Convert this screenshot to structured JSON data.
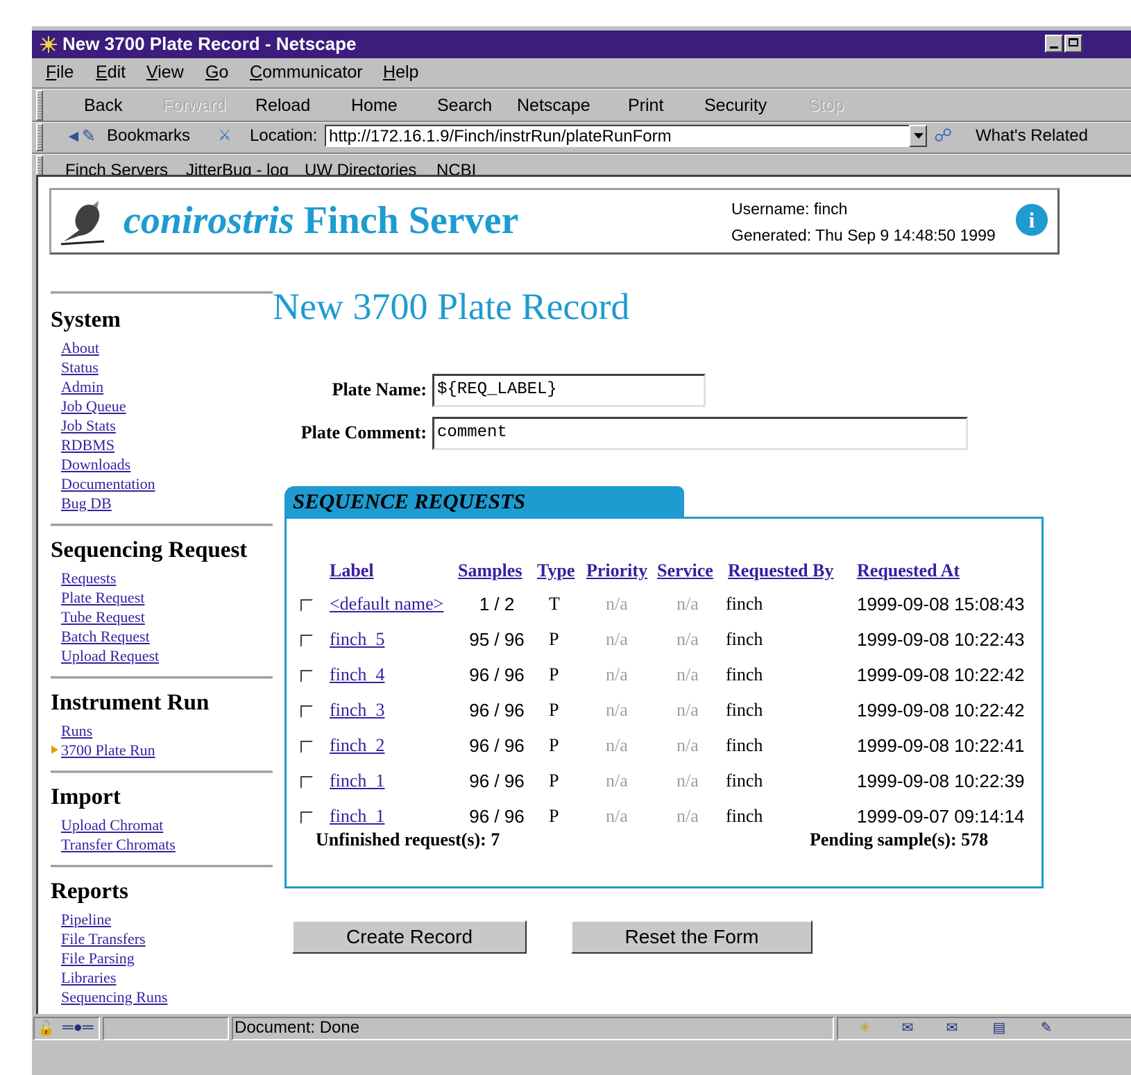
{
  "window": {
    "title": "New 3700 Plate Record - Netscape"
  },
  "menu": [
    {
      "key": "F",
      "rest": "ile"
    },
    {
      "key": "E",
      "rest": "dit"
    },
    {
      "key": "V",
      "rest": "iew"
    },
    {
      "key": "G",
      "rest": "o"
    },
    {
      "key": "C",
      "rest": "ommunicator"
    },
    {
      "key": "H",
      "rest": "elp"
    }
  ],
  "toolbar": {
    "back": "Back",
    "forward": "Forward",
    "reload": "Reload",
    "home": "Home",
    "search": "Search",
    "netscape": "Netscape",
    "print": "Print",
    "security": "Security",
    "stop": "Stop"
  },
  "location": {
    "bookmarks": "Bookmarks",
    "label": "Location:",
    "url": "http://172.16.1.9/Finch/instrRun/plateRunForm",
    "related": "What's Related"
  },
  "personal": [
    "Finch Servers",
    "JitterBug - log",
    "UW Directories",
    "NCBI"
  ],
  "banner": {
    "title_italic": "conirostris",
    "title_rest": " Finch Server",
    "username": "Username:  finch",
    "generated": "Generated:  Thu Sep 9 14:48:50 1999"
  },
  "sidebar": {
    "system": {
      "title": "System",
      "links": [
        "About",
        "Status",
        "Admin",
        "Job Queue",
        "Job Stats",
        "RDBMS",
        "Downloads",
        "Documentation",
        "Bug DB"
      ]
    },
    "sequencing": {
      "title": "Sequencing Request",
      "links": [
        "Requests",
        "Plate Request",
        "Tube Request",
        "Batch Request",
        "Upload Request"
      ]
    },
    "instrument": {
      "title": "Instrument Run",
      "links": [
        "Runs",
        "3700 Plate Run"
      ]
    },
    "import": {
      "title": "Import",
      "links": [
        "Upload Chromat",
        "Transfer Chromats"
      ]
    },
    "reports": {
      "title": "Reports",
      "links": [
        "Pipeline",
        "File Transfers",
        "File Parsing",
        "Libraries",
        "Sequencing Runs"
      ]
    }
  },
  "page": {
    "heading": "New 3700 Plate Record",
    "plate_name_label": "Plate Name:",
    "plate_name_value": "${REQ_LABEL}",
    "plate_comment_label": "Plate Comment:",
    "plate_comment_value": "comment"
  },
  "sequence": {
    "title": "SEQUENCE REQUESTS",
    "headers": {
      "label": "Label",
      "samples": "Samples",
      "type": "Type",
      "priority": "Priority",
      "service": "Service",
      "requested_by": "Requested By",
      "requested_at": "Requested At"
    },
    "rows": [
      {
        "label": "<default name>",
        "samples": "1 / 2",
        "type": "T",
        "priority": "n/a",
        "service": "n/a",
        "by": "finch",
        "at": "1999-09-08 15:08:43"
      },
      {
        "label": "finch_5",
        "samples": "95 / 96",
        "type": "P",
        "priority": "n/a",
        "service": "n/a",
        "by": "finch",
        "at": "1999-09-08 10:22:43"
      },
      {
        "label": "finch_4",
        "samples": "96 / 96",
        "type": "P",
        "priority": "n/a",
        "service": "n/a",
        "by": "finch",
        "at": "1999-09-08 10:22:42"
      },
      {
        "label": "finch_3",
        "samples": "96 / 96",
        "type": "P",
        "priority": "n/a",
        "service": "n/a",
        "by": "finch",
        "at": "1999-09-08 10:22:42"
      },
      {
        "label": "finch_2",
        "samples": "96 / 96",
        "type": "P",
        "priority": "n/a",
        "service": "n/a",
        "by": "finch",
        "at": "1999-09-08 10:22:41"
      },
      {
        "label": "finch_1",
        "samples": "96 / 96",
        "type": "P",
        "priority": "n/a",
        "service": "n/a",
        "by": "finch",
        "at": "1999-09-08 10:22:39"
      },
      {
        "label": "finch_1",
        "samples": "96 / 96",
        "type": "P",
        "priority": "n/a",
        "service": "n/a",
        "by": "finch",
        "at": "1999-09-07 09:14:14"
      }
    ],
    "unfinished": "Unfinished request(s):  7",
    "pending": "Pending sample(s):  578"
  },
  "buttons": {
    "create": "Create Record",
    "reset": "Reset the Form"
  },
  "status": {
    "text": "Document: Done"
  },
  "colors": {
    "accent": "#1e9bd0",
    "link": "#3b1ea0",
    "titlebar": "#3c1c7c"
  }
}
